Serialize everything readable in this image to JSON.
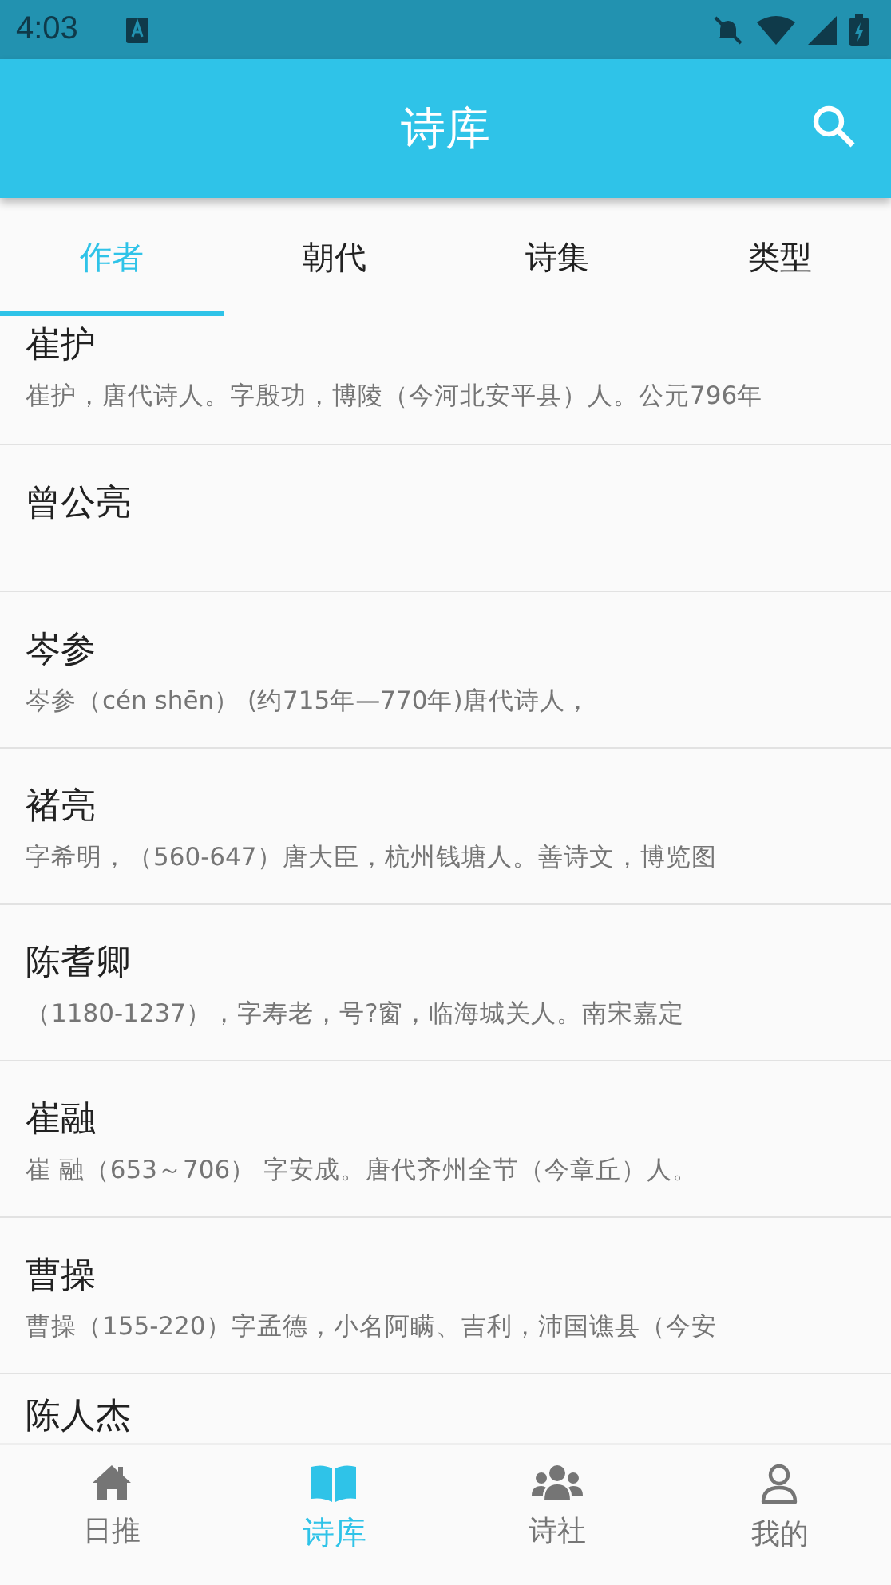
{
  "status_bar": {
    "time": "4:03"
  },
  "app_bar": {
    "title": "诗库"
  },
  "tabs": [
    {
      "label": "作者",
      "selected": true
    },
    {
      "label": "朝代",
      "selected": false
    },
    {
      "label": "诗集",
      "selected": false
    },
    {
      "label": "类型",
      "selected": false
    }
  ],
  "authors": [
    {
      "name": "崔护",
      "description": "崔护，唐代诗人。字殷功，博陵（今河北安平县）人。公元796年"
    },
    {
      "name": "曾公亮"
    },
    {
      "name": "岑参",
      "description": "岑参（cén shēn） (约715年—770年)唐代诗人，"
    },
    {
      "name": "褚亮",
      "description": "字希明，（560-647）唐大臣，杭州钱塘人。善诗文，博览图"
    },
    {
      "name": "陈耆卿",
      "description": "（1180-1237），字寿老，号?窗，临海城关人。南宋嘉定"
    },
    {
      "name": "崔融",
      "description": "崔 融（653～706） 字安成。唐代齐州全节（今章丘）人。"
    },
    {
      "name": "曹操",
      "description": "曹操（155-220）字孟德，小名阿瞒、吉利，沛国谯县（今安"
    },
    {
      "name": "陈人杰"
    }
  ],
  "bottom_nav": [
    {
      "kind": "home",
      "label": "日推",
      "selected": false
    },
    {
      "kind": "book",
      "label": "诗库",
      "selected": true
    },
    {
      "kind": "group",
      "label": "诗社",
      "selected": false
    },
    {
      "kind": "person",
      "label": "我的",
      "selected": false
    }
  ]
}
